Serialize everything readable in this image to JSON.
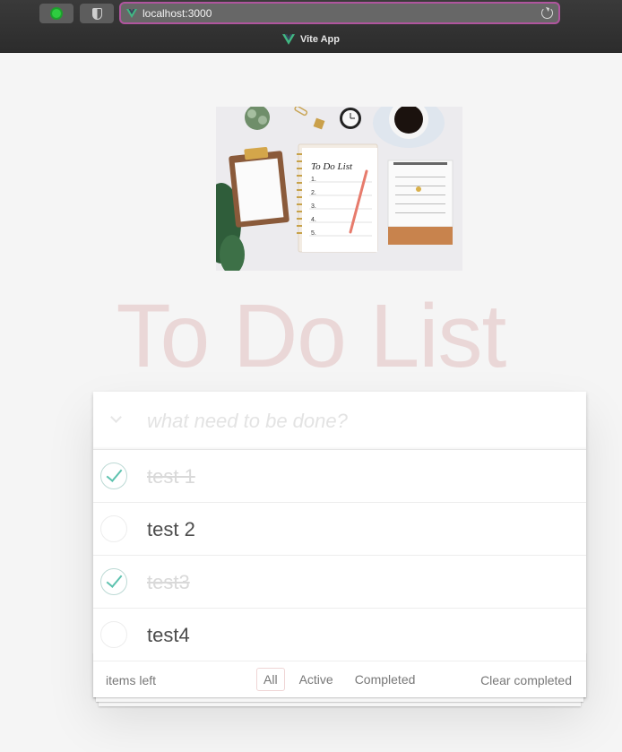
{
  "browser": {
    "url": "localhost:3000",
    "tab_title": "Vite App"
  },
  "app": {
    "title": "To Do List",
    "new_todo_placeholder": "what need to be done?",
    "todos": [
      {
        "text": "test 1",
        "completed": true
      },
      {
        "text": "test 2",
        "completed": false
      },
      {
        "text": "test3",
        "completed": true
      },
      {
        "text": "test4",
        "completed": false
      }
    ],
    "footer": {
      "items_left": "items left",
      "filters": [
        "All",
        "Active",
        "Completed"
      ],
      "selected_filter": "All",
      "clear_completed": "Clear completed"
    }
  },
  "hero_image": {
    "notepad_heading": "To Do List",
    "notepad_lines": [
      "1.",
      "2.",
      "3.",
      "4.",
      "5."
    ]
  },
  "colors": {
    "title": "rgba(175,47,47,0.15)",
    "check_accent": "#5dc2af",
    "url_border": "#b0559e",
    "vite_green": "#41b883"
  }
}
